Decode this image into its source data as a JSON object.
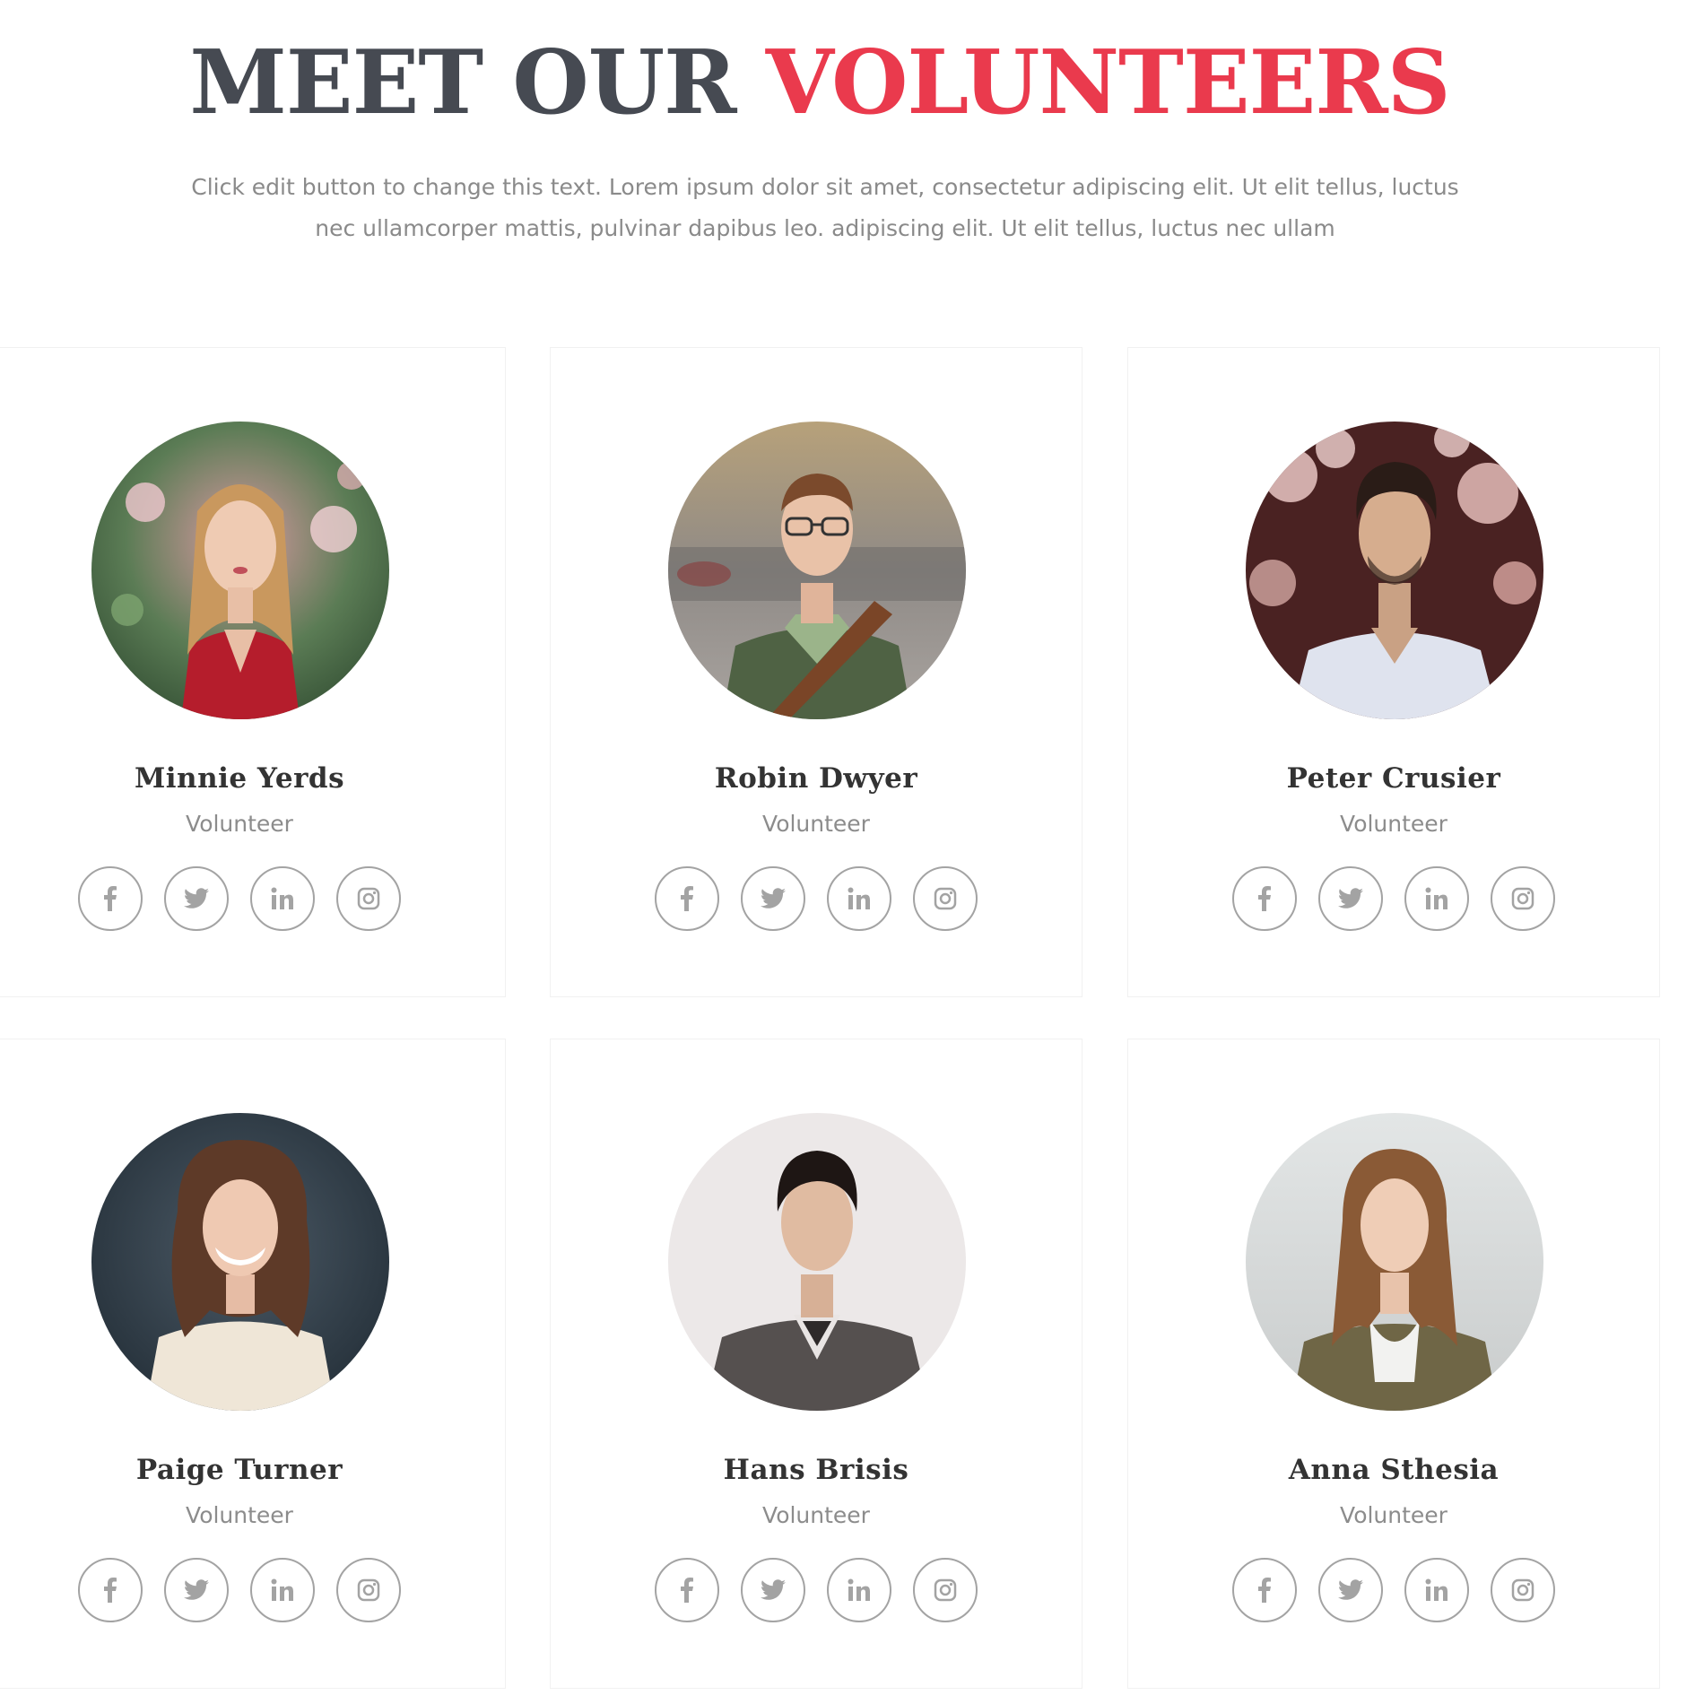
{
  "header": {
    "title_part1": "MEET OUR",
    "title_part2": "VOLUNTEERS",
    "subtitle": "Click edit button to change this text. Lorem ipsum dolor sit amet, consectetur adipiscing elit. Ut elit tellus, luctus nec ullamcorper mattis, pulvinar dapibus leo. adipiscing elit. Ut elit tellus, luctus nec ullam"
  },
  "colors": {
    "title_dark": "#464a52",
    "title_accent": "#ea3a4d",
    "icon_stroke": "#a3a3a3"
  },
  "social_icons": [
    "facebook-icon",
    "twitter-icon",
    "linkedin-icon",
    "instagram-icon"
  ],
  "volunteers": [
    {
      "name": "Minnie Yerds",
      "role": "Volunteer"
    },
    {
      "name": "Robin Dwyer",
      "role": "Volunteer"
    },
    {
      "name": "Peter Crusier",
      "role": "Volunteer"
    },
    {
      "name": "Paige Turner",
      "role": "Volunteer"
    },
    {
      "name": "Hans Brisis",
      "role": "Volunteer"
    },
    {
      "name": "Anna Sthesia",
      "role": "Volunteer"
    }
  ]
}
